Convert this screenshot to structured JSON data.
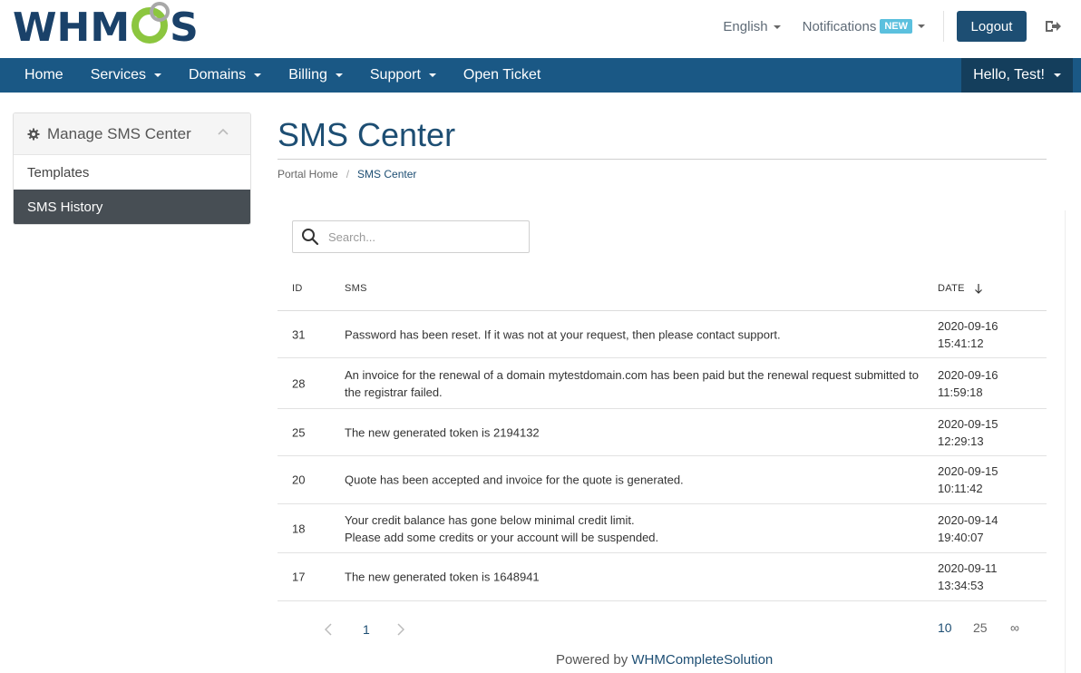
{
  "brand": {
    "logo_text_1": "WHM",
    "logo_text_2": "S",
    "accent": "#8cc63f",
    "navy": "#1a4169"
  },
  "header": {
    "language": "English",
    "notifications_label": "Notifications",
    "notifications_badge": "NEW",
    "logout_label": "Logout"
  },
  "nav": {
    "items": [
      {
        "label": "Home",
        "has_caret": false
      },
      {
        "label": "Services",
        "has_caret": true
      },
      {
        "label": "Domains",
        "has_caret": true
      },
      {
        "label": "Billing",
        "has_caret": true
      },
      {
        "label": "Support",
        "has_caret": true
      },
      {
        "label": "Open Ticket",
        "has_caret": false
      }
    ],
    "greeting": "Hello, Test!"
  },
  "sidebar": {
    "title": "Manage SMS Center",
    "items": [
      {
        "label": "Templates",
        "active": false
      },
      {
        "label": "SMS History",
        "active": true
      }
    ]
  },
  "main": {
    "title": "SMS Center",
    "breadcrumb": [
      "Portal Home",
      "SMS Center"
    ],
    "search_placeholder": "Search...",
    "columns": {
      "id": "ID",
      "sms": "SMS",
      "date": "DATE"
    },
    "rows": [
      {
        "id": "31",
        "sms": [
          "Password has been reset. If it was not at your request, then please contact support."
        ],
        "date": [
          "2020-09-16",
          "15:41:12"
        ]
      },
      {
        "id": "28",
        "sms": [
          "An invoice for the renewal of a domain mytestdomain.com has been paid but the renewal request submitted to",
          "the registrar failed."
        ],
        "date": [
          "2020-09-16",
          "11:59:18"
        ]
      },
      {
        "id": "25",
        "sms": [
          "The new generated token is 2194132"
        ],
        "date": [
          "2020-09-15",
          "12:29:13"
        ]
      },
      {
        "id": "20",
        "sms": [
          "Quote has been accepted and invoice for the quote is generated."
        ],
        "date": [
          "2020-09-15",
          "10:11:42"
        ]
      },
      {
        "id": "18",
        "sms": [
          "Your credit balance has gone below minimal credit limit.",
          "Please add some credits or your account will be suspended."
        ],
        "date": [
          "2020-09-14",
          "19:40:07"
        ]
      },
      {
        "id": "17",
        "sms": [
          "The new generated token is 1648941"
        ],
        "date": [
          "2020-09-11",
          "13:34:53"
        ]
      }
    ],
    "pagination": {
      "prev": "‹",
      "current_page": "1",
      "next": "›",
      "page_lengths": [
        "10",
        "25",
        "∞"
      ]
    }
  },
  "footer": {
    "prefix": "Powered by ",
    "link": "WHMCompleteSolution"
  }
}
